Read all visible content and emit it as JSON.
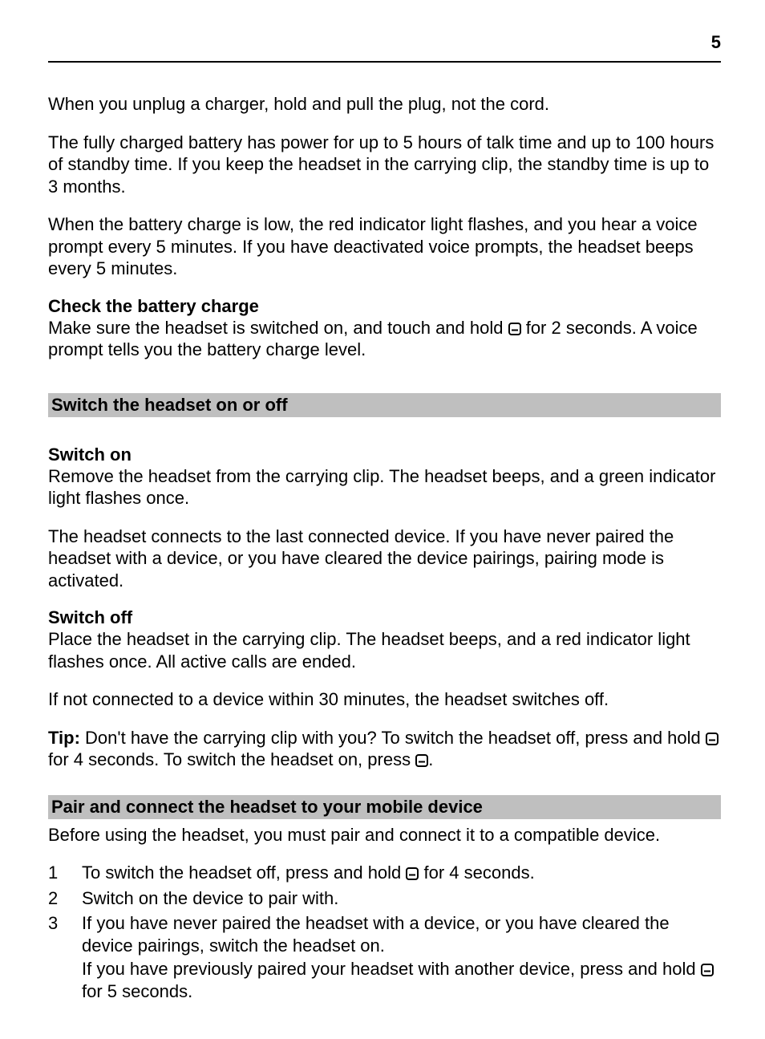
{
  "page_number": "5",
  "intro": {
    "p1": "When you unplug a charger, hold and pull the plug, not the cord.",
    "p2": "The fully charged battery has power for up to 5 hours of talk time and up to 100 hours of standby time. If you keep the headset in the carrying clip, the standby time is up to 3 months.",
    "p3": "When the battery charge is low, the red indicator light flashes, and you hear a voice prompt every 5 minutes. If you have deactivated voice prompts, the headset beeps every 5 minutes."
  },
  "check_battery": {
    "heading": "Check the battery charge",
    "text_before_icon": "Make sure the headset is switched on, and touch and hold ",
    "text_after_icon": " for 2 seconds. A voice prompt tells you the battery charge level."
  },
  "switch_section": {
    "title": "Switch the headset on or off",
    "on_heading": "Switch on",
    "on_p1": "Remove the headset from the carrying clip. The headset beeps, and a green indicator light flashes once.",
    "on_p2": "The headset connects to the last connected device. If you have never paired the headset with a device, or you have cleared the device pairings, pairing mode is activated.",
    "off_heading": "Switch off",
    "off_p1": "Place the headset in the carrying clip. The headset beeps, and a red indicator light flashes once. All active calls are ended.",
    "off_p2": "If not connected to a device within 30 minutes, the headset switches off.",
    "tip_label": "Tip:",
    "tip_before_icon1": " Don't have the carrying clip with you? To switch the headset off, press and hold ",
    "tip_between": " for 4 seconds. To switch the headset on, press ",
    "tip_after_icon2": "."
  },
  "pair_section": {
    "title": "Pair and connect the headset to your mobile device",
    "intro": "Before using the headset, you must pair and connect it to a compatible device.",
    "steps": {
      "s1_before": "To switch the headset off, press and hold ",
      "s1_after": " for 4 seconds.",
      "s2": "Switch on the device to pair with.",
      "s3a": "If you have never paired the headset with a device, or you have cleared the device pairings, switch the headset on.",
      "s3b_before": "If you have previously paired your headset with another device, press and hold ",
      "s3b_after": " for 5 seconds."
    },
    "nums": {
      "n1": "1",
      "n2": "2",
      "n3": "3"
    }
  },
  "icon_name": "multifunction-key-icon"
}
